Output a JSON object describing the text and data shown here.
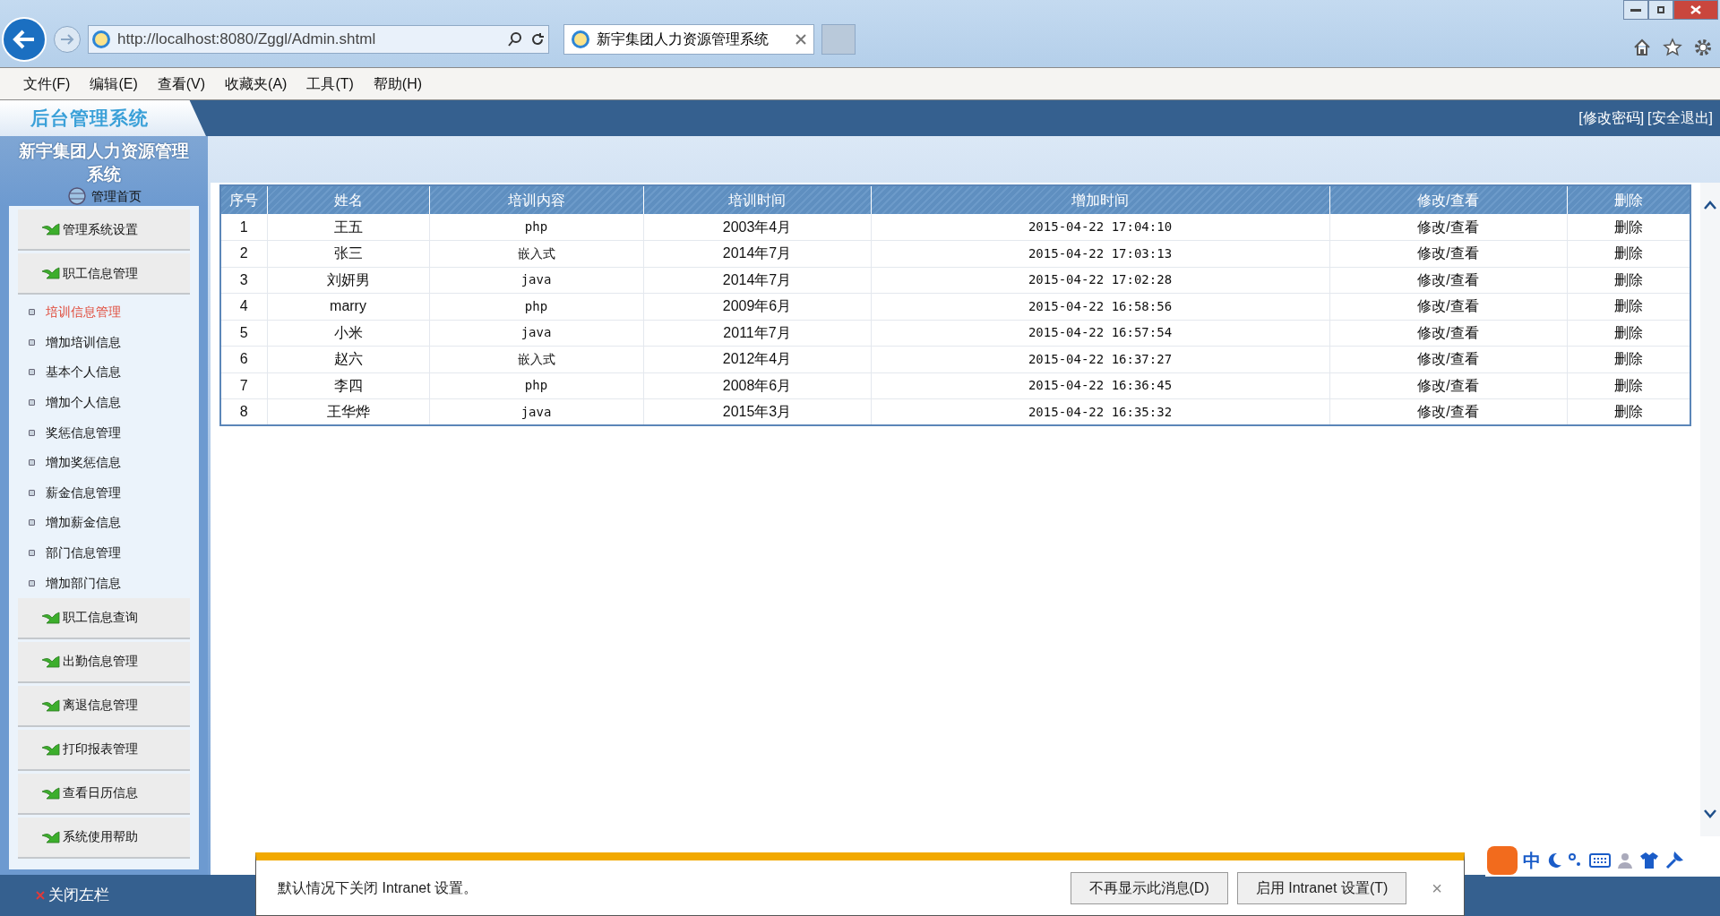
{
  "browser": {
    "address": "http://localhost:8080/Zggl/Admin.shtml",
    "tab_title": "新宇集团人力资源管理系统",
    "menu": [
      "文件(F)",
      "编辑(E)",
      "查看(V)",
      "收藏夹(A)",
      "工具(T)",
      "帮助(H)"
    ]
  },
  "header": {
    "logo": "后台管理系统",
    "links": [
      "[修改密码]",
      "[安全退出]"
    ]
  },
  "sidebar": {
    "title": "新宇集团人力资源管理系统",
    "home": "管理首页",
    "items": [
      {
        "kind": "section",
        "label": "管理系统设置"
      },
      {
        "kind": "section",
        "label": "职工信息管理"
      },
      {
        "kind": "link",
        "label": "培训信息管理",
        "selected": true
      },
      {
        "kind": "link",
        "label": "增加培训信息",
        "selected": false
      },
      {
        "kind": "link",
        "label": "基本个人信息",
        "selected": false
      },
      {
        "kind": "link",
        "label": "增加个人信息",
        "selected": false
      },
      {
        "kind": "link",
        "label": "奖惩信息管理",
        "selected": false
      },
      {
        "kind": "link",
        "label": "增加奖惩信息",
        "selected": false
      },
      {
        "kind": "link",
        "label": "薪金信息管理",
        "selected": false
      },
      {
        "kind": "link",
        "label": "增加薪金信息",
        "selected": false
      },
      {
        "kind": "link",
        "label": "部门信息管理",
        "selected": false
      },
      {
        "kind": "link",
        "label": "增加部门信息",
        "selected": false
      },
      {
        "kind": "section",
        "label": "职工信息查询"
      },
      {
        "kind": "section",
        "label": "出勤信息管理"
      },
      {
        "kind": "section",
        "label": "离退信息管理"
      },
      {
        "kind": "section",
        "label": "打印报表管理"
      },
      {
        "kind": "section",
        "label": "查看日历信息"
      },
      {
        "kind": "section",
        "label": "系统使用帮助"
      }
    ],
    "close": "关闭左栏"
  },
  "table": {
    "columns": [
      "序号",
      "姓名",
      "培训内容",
      "培训时间",
      "增加时间",
      "修改/查看",
      "删除"
    ],
    "rows": [
      [
        "1",
        "王五",
        "php",
        "2003年4月",
        "2015-04-22 17:04:10",
        "修改/查看",
        "删除"
      ],
      [
        "2",
        "张三",
        "嵌入式",
        "2014年7月",
        "2015-04-22 17:03:13",
        "修改/查看",
        "删除"
      ],
      [
        "3",
        "刘妍男",
        "java",
        "2014年7月",
        "2015-04-22 17:02:28",
        "修改/查看",
        "删除"
      ],
      [
        "4",
        "marry",
        "php",
        "2009年6月",
        "2015-04-22 16:58:56",
        "修改/查看",
        "删除"
      ],
      [
        "5",
        "小米",
        "java",
        "2011年7月",
        "2015-04-22 16:57:54",
        "修改/查看",
        "删除"
      ],
      [
        "6",
        "赵六",
        "嵌入式",
        "2012年4月",
        "2015-04-22 16:37:27",
        "修改/查看",
        "删除"
      ],
      [
        "7",
        "李四",
        "php",
        "2008年6月",
        "2015-04-22 16:36:45",
        "修改/查看",
        "删除"
      ],
      [
        "8",
        "王华烨",
        "java",
        "2015年3月",
        "2015-04-22 16:35:32",
        "修改/查看",
        "删除"
      ]
    ]
  },
  "notification": {
    "message": "默认情况下关闭 Intranet 设置。",
    "buttons": [
      "不再显示此消息(D)",
      "启用 Intranet 设置(T)"
    ],
    "close": "×"
  },
  "ime": {
    "mode": "中"
  }
}
